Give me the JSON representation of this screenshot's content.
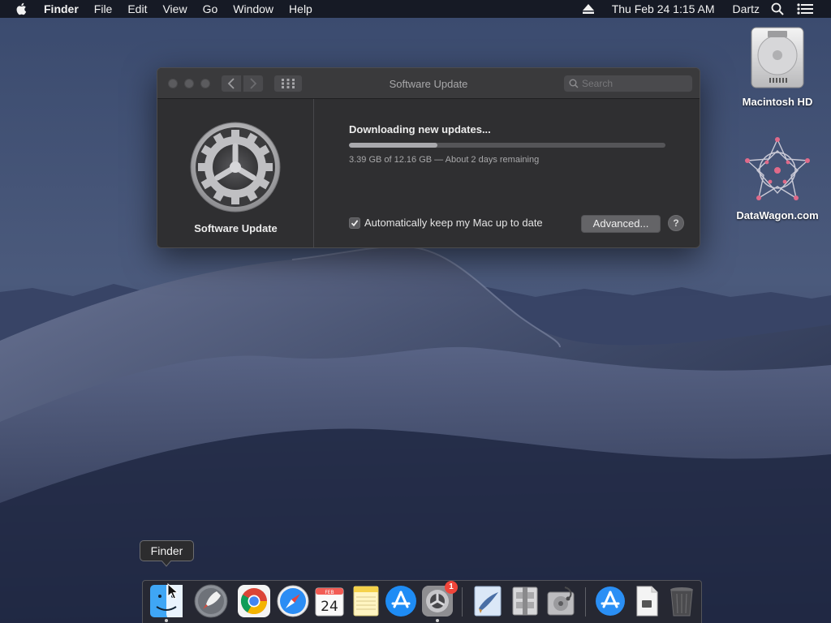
{
  "menubar": {
    "app_name": "Finder",
    "items": [
      "File",
      "Edit",
      "View",
      "Go",
      "Window",
      "Help"
    ],
    "clock": "Thu Feb 24  1:15 AM",
    "user": "Dartz",
    "icons": [
      "apple-icon",
      "eject-icon",
      "spotlight-icon",
      "notification-center-icon"
    ]
  },
  "desktop": {
    "icons": [
      {
        "label": "Macintosh HD",
        "icon": "hard-drive-icon"
      },
      {
        "label": "DataWagon.com",
        "icon": "network-star-icon"
      }
    ]
  },
  "window": {
    "title": "Software Update",
    "search_placeholder": "Search",
    "sidebar_label": "Software Update",
    "status_title": "Downloading new updates...",
    "progress_fraction": 0.2786,
    "status_detail": "3.39 GB of 12.16 GB — About 2 days remaining",
    "auto_update_label": "Automatically keep my Mac up to date",
    "auto_update_checked": true,
    "advanced_label": "Advanced...",
    "help_label": "?"
  },
  "tooltip": {
    "text": "Finder"
  },
  "dock": {
    "items": [
      {
        "name": "Finder",
        "icon": "finder-icon",
        "running": true
      },
      {
        "name": "Launchpad",
        "icon": "launchpad-icon"
      },
      {
        "name": "Chrome",
        "icon": "chrome-icon"
      },
      {
        "name": "Safari",
        "icon": "safari-icon"
      },
      {
        "name": "Calendar",
        "icon": "calendar-icon",
        "month": "FEB",
        "day": "24"
      },
      {
        "name": "Notes",
        "icon": "notes-icon"
      },
      {
        "name": "App Store",
        "icon": "app-store-icon"
      },
      {
        "name": "System Preferences",
        "icon": "system-preferences-icon",
        "running": true,
        "badge": "1"
      },
      {
        "name": "Mail",
        "icon": "mail-icon"
      },
      {
        "name": "Archive Utility",
        "icon": "archive-utility-icon"
      },
      {
        "name": "Disk Utility",
        "icon": "disk-utility-icon"
      },
      {
        "name": "Downloads",
        "icon": "app-store-folder-icon"
      },
      {
        "name": "Document",
        "icon": "document-icon"
      },
      {
        "name": "Trash",
        "icon": "trash-icon"
      }
    ]
  },
  "colors": {
    "menubar_bg": "#14161e",
    "window_bg": "#2f2f31",
    "progress_fill": "#a9a9ad",
    "badge_red": "#f0453a"
  }
}
